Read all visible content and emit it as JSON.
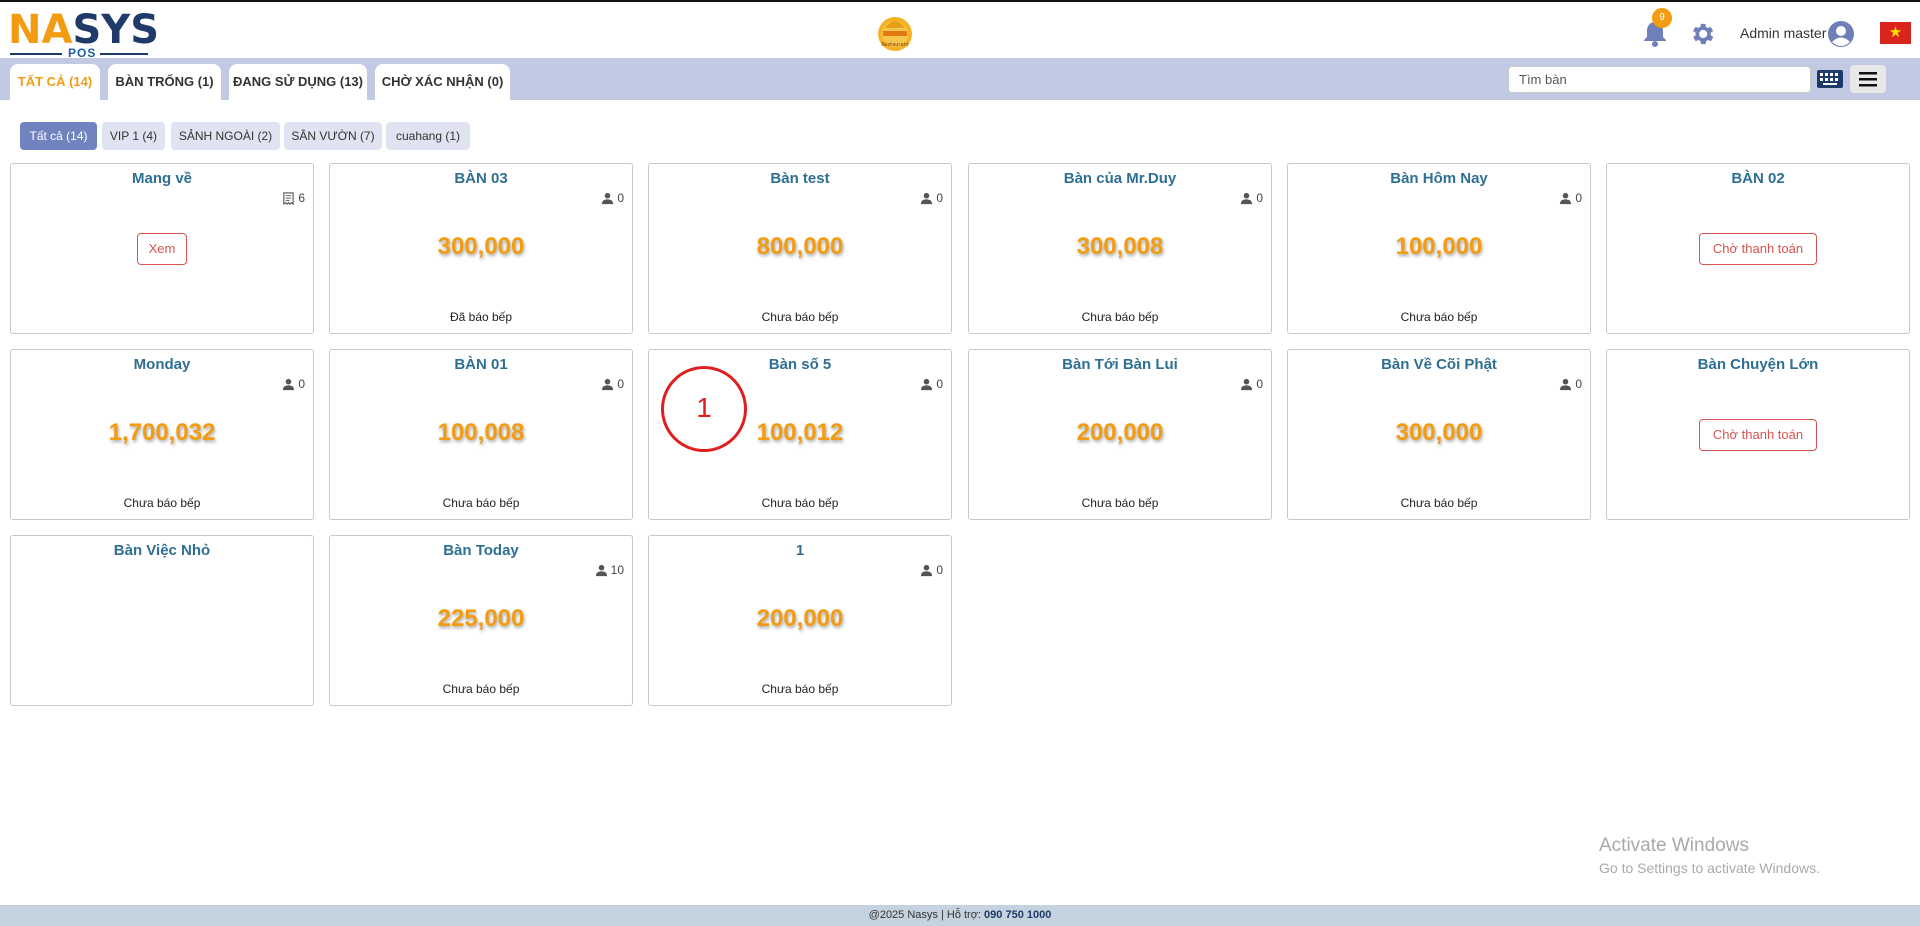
{
  "header": {
    "logo_letters": "NASYS",
    "logo_sub": "POS",
    "center_logo_text": "Restaurant",
    "notification_count": "9",
    "user_name": "Admin master",
    "language_flag": "VN"
  },
  "tabs": [
    {
      "label": "TẤT CẢ (14)",
      "active": true
    },
    {
      "label": "BÀN TRỐNG (1)",
      "active": false
    },
    {
      "label": "ĐANG SỬ DỤNG (13)",
      "active": false
    },
    {
      "label": "CHỜ XÁC NHẬN (0)",
      "active": false
    }
  ],
  "search": {
    "placeholder": "Tìm bàn"
  },
  "filters": [
    {
      "label": "Tất cả (14)",
      "active": true
    },
    {
      "label": "VIP 1 (4)",
      "active": false
    },
    {
      "label": "SẢNH NGOÀI (2)",
      "active": false
    },
    {
      "label": "SÂN VƯỜN (7)",
      "active": false
    },
    {
      "label": "cuahang (1)",
      "active": false
    }
  ],
  "tables": [
    {
      "name": "Mang về",
      "count": "6",
      "count_icon": "receipt-icon",
      "button": "Xem"
    },
    {
      "name": "BÀN 03",
      "count": "0",
      "count_icon": "person-icon",
      "amount": "300,000",
      "status": "Đã báo bếp"
    },
    {
      "name": "Bàn test",
      "count": "0",
      "count_icon": "person-icon",
      "amount": "800,000",
      "status": "Chưa báo bếp"
    },
    {
      "name": "Bàn của Mr.Duy",
      "count": "0",
      "count_icon": "person-icon",
      "amount": "300,008",
      "status": "Chưa báo bếp"
    },
    {
      "name": "Bàn Hôm Nay",
      "count": "0",
      "count_icon": "person-icon",
      "amount": "100,000",
      "status": "Chưa báo bếp"
    },
    {
      "name": "BÀN 02",
      "button": "Chờ thanh toán"
    },
    {
      "name": "Monday",
      "count": "0",
      "count_icon": "person-icon",
      "amount": "1,700,032",
      "status": "Chưa báo bếp"
    },
    {
      "name": "BÀN 01",
      "count": "0",
      "count_icon": "person-icon",
      "amount": "100,008",
      "status": "Chưa báo bếp"
    },
    {
      "name": "Bàn số 5",
      "count": "0",
      "count_icon": "person-icon",
      "amount": "100,012",
      "status": "Chưa báo bếp"
    },
    {
      "name": "Bàn Tới Bàn Lui",
      "count": "0",
      "count_icon": "person-icon",
      "amount": "200,000",
      "status": "Chưa báo bếp"
    },
    {
      "name": "Bàn Về Cõi Phật",
      "count": "0",
      "count_icon": "person-icon",
      "amount": "300,000",
      "status": "Chưa báo bếp"
    },
    {
      "name": "Bàn Chuyện Lớn",
      "button": "Chờ thanh toán"
    },
    {
      "name": "Bàn Việc Nhỏ"
    },
    {
      "name": "Bàn Today",
      "count": "10",
      "count_icon": "person-icon",
      "amount": "225,000",
      "status": "Chưa báo bếp"
    },
    {
      "name": "1",
      "count": "0",
      "count_icon": "person-icon",
      "amount": "200,000",
      "status": "Chưa báo bếp"
    }
  ],
  "annotation_marker": "1",
  "watermark": {
    "title": "Activate Windows",
    "subtitle": "Go to Settings to activate Windows."
  },
  "footer": {
    "text": "@2025 Nasys | Hỗ trợ: ",
    "phone": "090 750 1000"
  },
  "colors": {
    "accent": "#f39c12",
    "tab_bar": "#c2c9e3",
    "title": "#2e6f93",
    "danger": "#d9534f",
    "chip_active": "#7083be"
  }
}
